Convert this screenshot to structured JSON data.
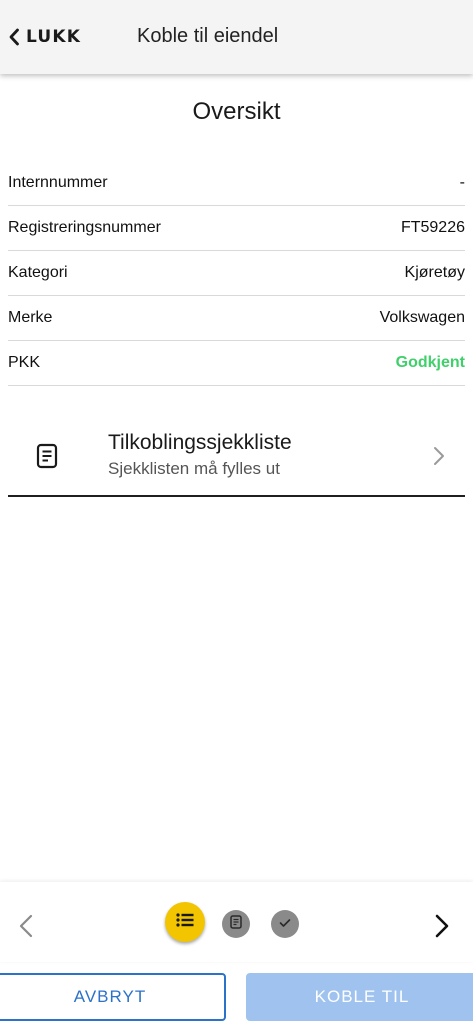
{
  "header": {
    "close_label": "LUKK",
    "title": "Koble til eiendel"
  },
  "overview": {
    "title": "Oversikt",
    "rows": [
      {
        "label": "Internnummer",
        "value": "-"
      },
      {
        "label": "Registreringsnummer",
        "value": "FT59226"
      },
      {
        "label": "Kategori",
        "value": "Kjøretøy"
      },
      {
        "label": "Merke",
        "value": "Volkswagen"
      },
      {
        "label": "PKK",
        "value": "Godkjent",
        "status_color": "#3fcf6b"
      }
    ]
  },
  "checklist": {
    "title": "Tilkoblingssjekkliste",
    "subtitle": "Sjekklisten må fylles ut",
    "icon": "document-icon"
  },
  "stepper": {
    "steps": [
      {
        "icon": "list-icon",
        "state": "active",
        "color": "#f2c500"
      },
      {
        "icon": "document-icon",
        "state": "inactive",
        "color": "#8a8a8a"
      },
      {
        "icon": "check-icon",
        "state": "inactive",
        "color": "#8a8a8a"
      }
    ]
  },
  "actions": {
    "cancel_label": "AVBRYT",
    "connect_label": "KOBLE TIL",
    "primary_color": "#2b72c9",
    "disabled_color": "#9fc3ee"
  }
}
